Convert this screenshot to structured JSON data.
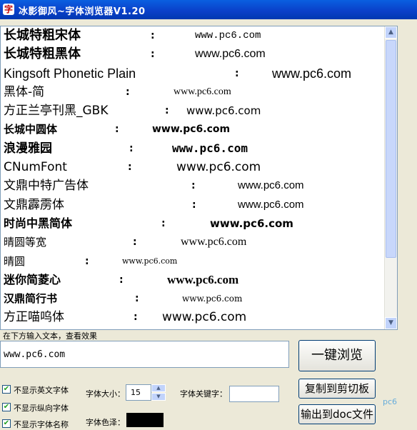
{
  "window": {
    "title": "冰影御风~字体浏览器V1.20"
  },
  "font_list": {
    "rows": [
      {
        "font": "长城特粗宋体",
        "sep": ":",
        "sample": "www.pc6.com"
      },
      {
        "font": "长城特粗黑体",
        "sep": ":",
        "sample": "www.pc6.com"
      },
      {
        "font": "Kingsoft Phonetic Plain",
        "sep": ":",
        "sample": "www.pc6.com"
      },
      {
        "font": "黑体-简",
        "sep": ":",
        "sample": "www.pc6.com"
      },
      {
        "font": "方正兰亭刊黑_GBK",
        "sep": ":",
        "sample": "www.pc6.com"
      },
      {
        "font": "长城中圆体",
        "sep": ":",
        "sample": "www.pc6.com"
      },
      {
        "font": "浪漫雅园",
        "sep": ":",
        "sample": "www.pc6.com"
      },
      {
        "font": "CNumFont",
        "sep": ":",
        "sample": "www.pc6.com"
      },
      {
        "font": "文鼎中特广告体",
        "sep": ":",
        "sample": "www.pc6.com"
      },
      {
        "font": "文鼎霹雳体",
        "sep": ":",
        "sample": "www.pc6.com"
      },
      {
        "font": "时尚中黑简体",
        "sep": ":",
        "sample": "www.pc6.com"
      },
      {
        "font": "晴圆等宽",
        "sep": ":",
        "sample": "www.pc6.com"
      },
      {
        "font": "晴圆",
        "sep": ":",
        "sample": "www.pc6.com"
      },
      {
        "font": "迷你简菱心",
        "sep": ":",
        "sample": "www.pc6.com"
      },
      {
        "font": "汉鼎简行书",
        "sep": ":",
        "sample": "www.pc6.com"
      },
      {
        "font": "方正喵呜体",
        "sep": ":",
        "sample": "www.pc6.com"
      }
    ]
  },
  "input": {
    "hint": "在下方输入文本，查看效果",
    "value": "www.pc6.com"
  },
  "buttons": {
    "browse": "一键浏览",
    "copy": "复制到剪切板",
    "export": "输出到doc文件"
  },
  "options": {
    "hide_english": "不显示英文字体",
    "hide_vertical": "不显示纵向字体",
    "hide_font_name": "不显示字体名称",
    "font_size_label": "字体大小：",
    "font_size_value": "15",
    "keyword_label": "字体关键字：",
    "keyword_value": "",
    "color_label": "字体色泽："
  },
  "colors": {
    "title_bar": "#0a4fd8",
    "font_color": "#000000"
  },
  "watermark": "pc6"
}
